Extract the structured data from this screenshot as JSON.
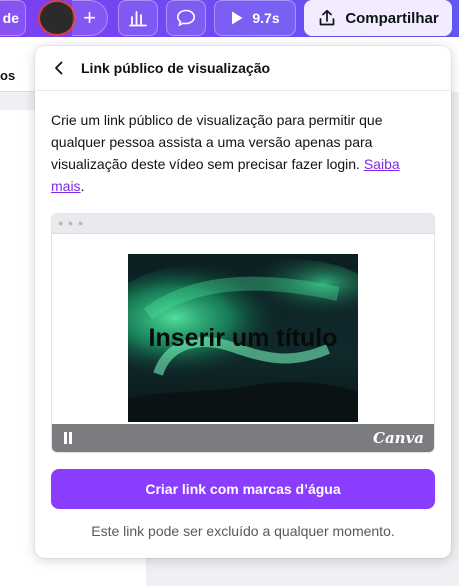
{
  "toolbar": {
    "left_label": "de",
    "plus_icon": "plus-icon",
    "chart_icon": "bar-chart-icon",
    "comment_icon": "comment-icon",
    "duration": "9.7s",
    "share_label": "Compartilhar",
    "accent_color": "#7b3ff0"
  },
  "canvas": {
    "left_text": "os"
  },
  "panel": {
    "title": "Link público de visualização",
    "description": "Crie um link público de visualização para permitir que qualquer pessoa assista a uma versão apenas para visualização deste vídeo sem precisar fazer login. ",
    "learn_more": "Saiba mais",
    "period": ".",
    "preview": {
      "slide_title": "Inserir um título",
      "brand": "Canva"
    },
    "cta_label": "Criar link com marcas d’água",
    "footnote": "Este link pode ser excluído a qualquer momento.",
    "cta_color": "#8b3dff"
  }
}
